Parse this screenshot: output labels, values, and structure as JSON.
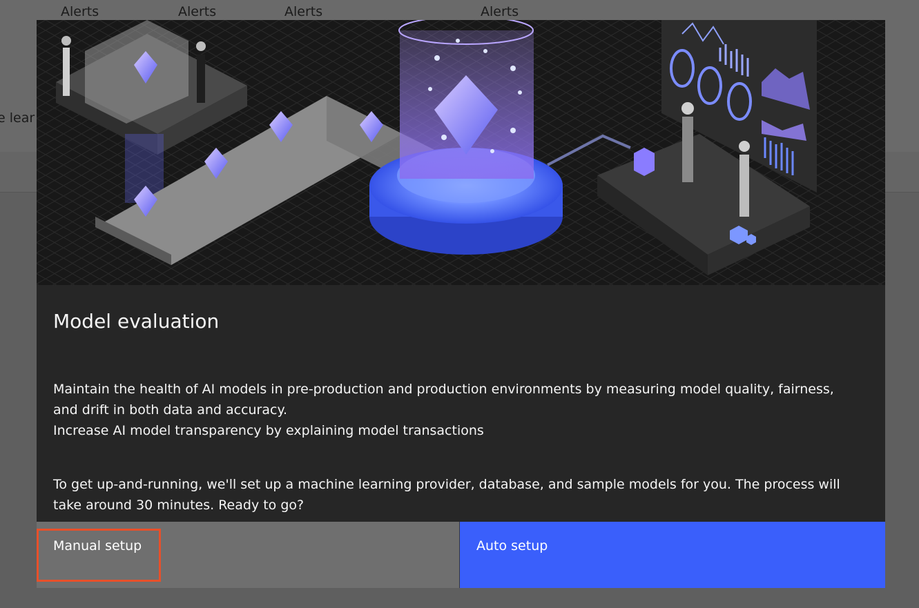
{
  "background": {
    "alerts": [
      "Alerts",
      "Alerts",
      "Alerts",
      "Alerts"
    ],
    "partial_text": "e lear"
  },
  "modal": {
    "title": "Model evaluation",
    "description_line1": "Maintain the health of AI models in pre-production and production environments by measuring model quality, fairness, and drift in both data and accuracy.",
    "description_line2": "Increase AI model transparency by explaining model transactions",
    "setup_note": "To get up-and-running, we'll set up a machine learning provider, database, and sample models for you. The process will take around 30 minutes. Ready to go?",
    "buttons": {
      "manual": "Manual setup",
      "auto": "Auto setup"
    },
    "hero_illustration": "isometric-ai-model-evaluation-illustration"
  },
  "colors": {
    "primary_button": "#3a5ffb",
    "secondary_button": "#6f6f6f",
    "modal_bg": "#262626",
    "highlight_border": "#e8502a"
  }
}
